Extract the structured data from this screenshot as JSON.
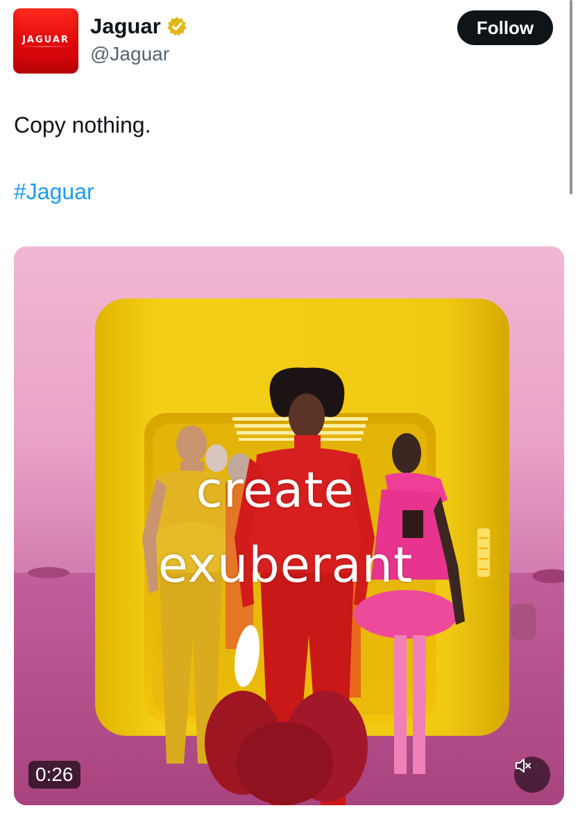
{
  "account": {
    "display_name": "Jaguar",
    "handle": "@Jaguar",
    "avatar_logo_text": "JAGUAR",
    "verified_badge": "gold-check-icon",
    "verified_color": "#e2b719"
  },
  "follow_button": {
    "label": "Follow"
  },
  "tweet": {
    "text": "Copy nothing.",
    "hashtag": "#Jaguar"
  },
  "media": {
    "overlay_line1": "create",
    "overlay_line2": "exuberant",
    "duration": "0:26",
    "mute_icon": "speaker-muted-icon"
  },
  "colors": {
    "brand_red": "#e0080a",
    "link_blue": "#1d9bf0",
    "text_primary": "#0f1419",
    "text_secondary": "#536471"
  }
}
